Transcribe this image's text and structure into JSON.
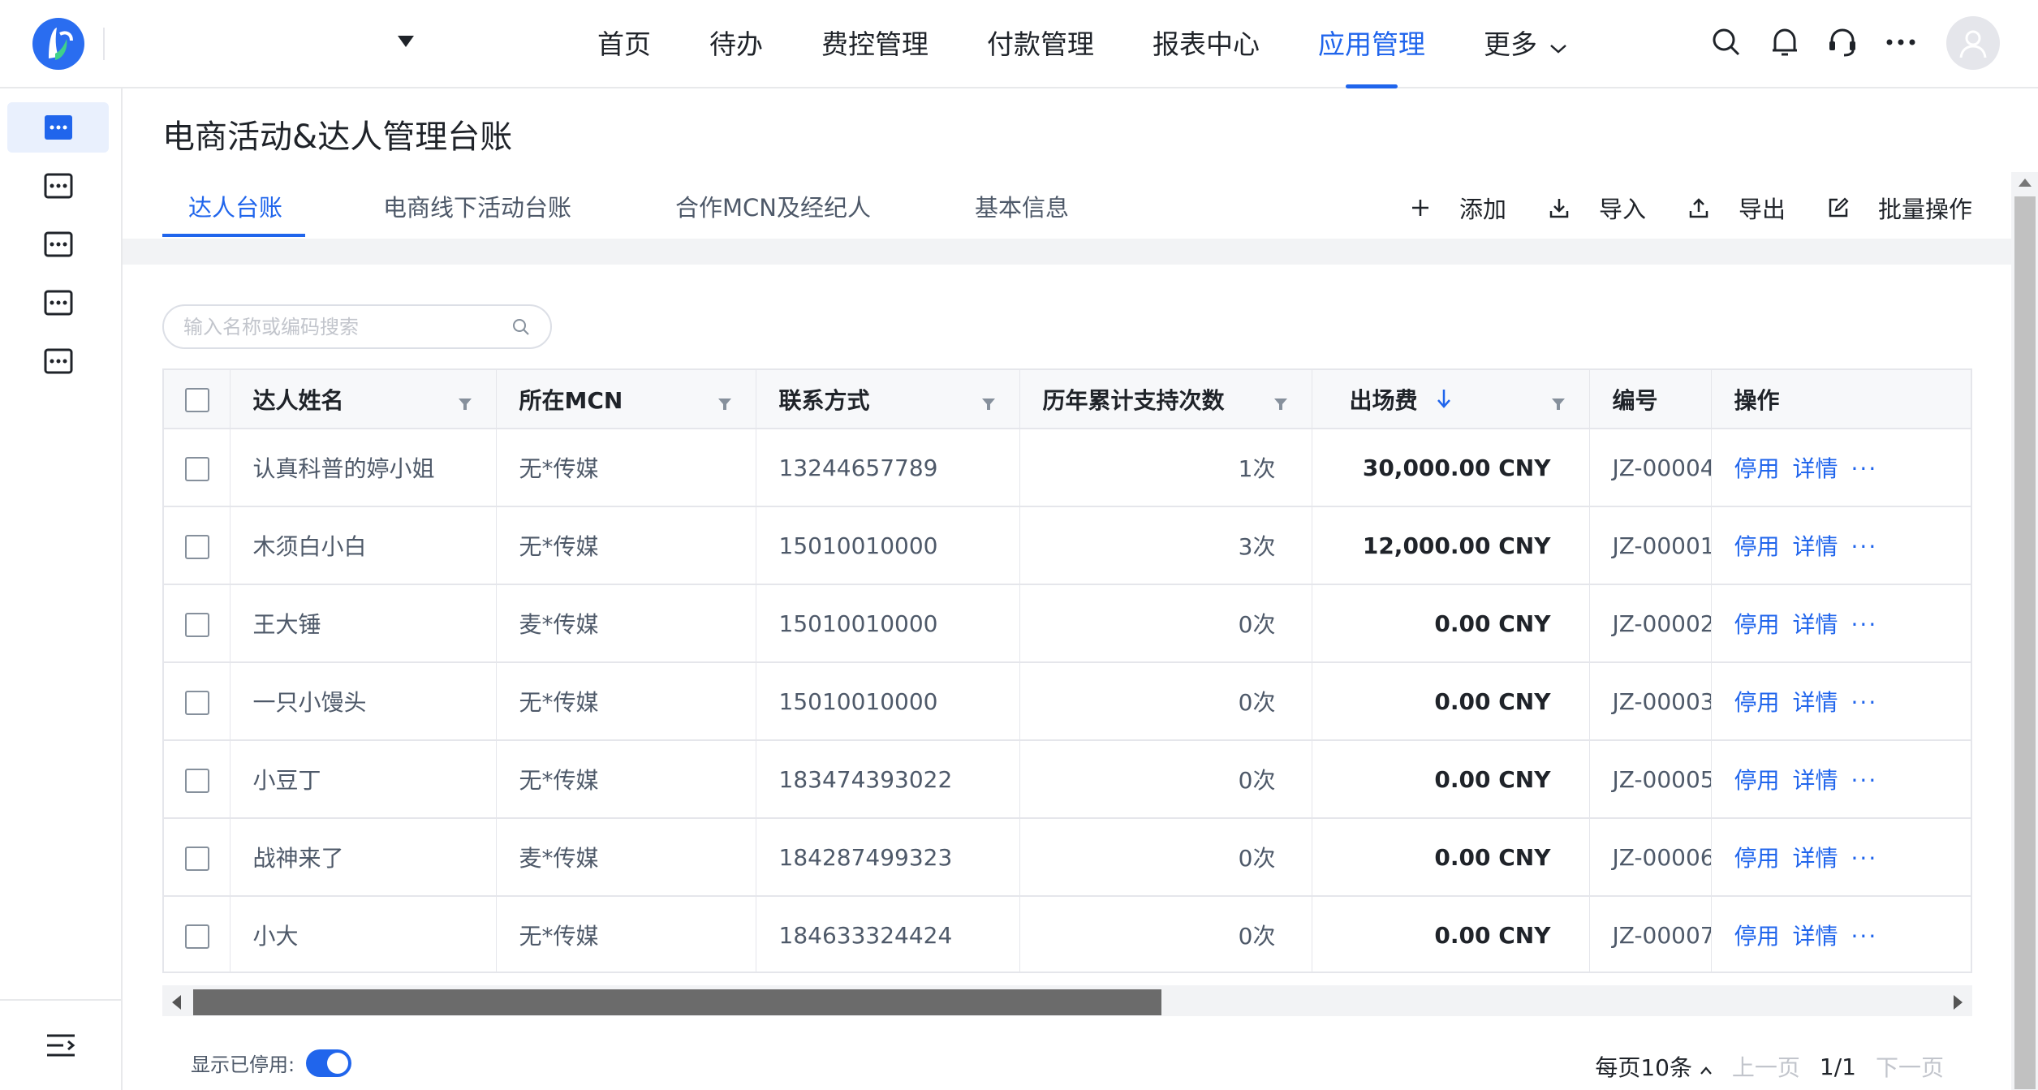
{
  "header": {
    "nav": [
      {
        "label": "首页",
        "active": false
      },
      {
        "label": "待办",
        "active": false
      },
      {
        "label": "费控管理",
        "active": false
      },
      {
        "label": "付款管理",
        "active": false
      },
      {
        "label": "报表中心",
        "active": false
      },
      {
        "label": "应用管理",
        "active": true
      },
      {
        "label": "更多",
        "active": false
      }
    ]
  },
  "page": {
    "title": "电商活动&达人管理台账",
    "tabs": [
      {
        "label": "达人台账",
        "active": true
      },
      {
        "label": "电商线下活动台账",
        "active": false
      },
      {
        "label": "合作MCN及经纪人",
        "active": false
      },
      {
        "label": "基本信息",
        "active": false
      }
    ],
    "toolbar": {
      "add": "添加",
      "import": "导入",
      "export": "导出",
      "batch": "批量操作"
    },
    "search": {
      "placeholder": "输入名称或编码搜索",
      "value": ""
    }
  },
  "table": {
    "columns": [
      "达人姓名",
      "所在MCN",
      "联系方式",
      "历年累计支持次数",
      "出场费",
      "编号",
      "操作"
    ],
    "actions": {
      "disable": "停用",
      "detail": "详情",
      "more": "···"
    },
    "rows": [
      {
        "name": "认真科普的婷小姐",
        "mcn": "无*传媒",
        "contact": "13244657789",
        "count": "1次",
        "fee": "30,000.00 CNY",
        "code": "JZ-00004"
      },
      {
        "name": "木须白小白",
        "mcn": "无*传媒",
        "contact": "15010010000",
        "count": "3次",
        "fee": "12,000.00 CNY",
        "code": "JZ-00001"
      },
      {
        "name": "王大锤",
        "mcn": "麦*传媒",
        "contact": "15010010000",
        "count": "0次",
        "fee": "0.00 CNY",
        "code": "JZ-00002"
      },
      {
        "name": "一只小馒头",
        "mcn": "无*传媒",
        "contact": "15010010000",
        "count": "0次",
        "fee": "0.00 CNY",
        "code": "JZ-00003"
      },
      {
        "name": "小豆丁",
        "mcn": "无*传媒",
        "contact": "183474393022",
        "count": "0次",
        "fee": "0.00 CNY",
        "code": "JZ-00005"
      },
      {
        "name": "战神来了",
        "mcn": "麦*传媒",
        "contact": "184287499323",
        "count": "0次",
        "fee": "0.00 CNY",
        "code": "JZ-00006"
      },
      {
        "name": "小大",
        "mcn": "无*传媒",
        "contact": "184633324424",
        "count": "0次",
        "fee": "0.00 CNY",
        "code": "JZ-00007"
      }
    ]
  },
  "footer": {
    "show_disabled_label": "显示已停用:",
    "show_disabled": true,
    "page_size": "每页10条",
    "prev": "上一页",
    "page_info": "1/1",
    "next": "下一页"
  },
  "colors": {
    "accent": "#2065ec",
    "text": "#1f2329",
    "muted": "#c2c5cc"
  }
}
